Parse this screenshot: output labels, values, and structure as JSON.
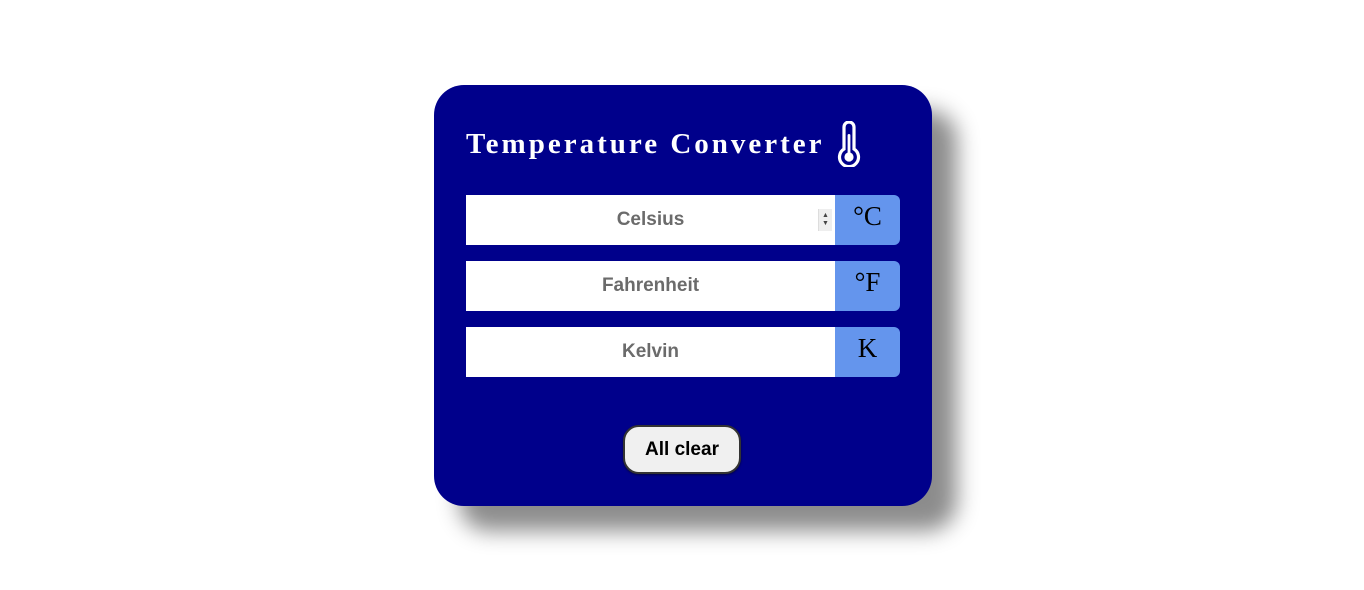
{
  "header": {
    "title": "Temperature Converter",
    "icon": "thermometer-icon"
  },
  "fields": [
    {
      "placeholder": "Celsius",
      "value": "",
      "unit": "°C"
    },
    {
      "placeholder": "Fahrenheit",
      "value": "",
      "unit": "°F"
    },
    {
      "placeholder": "Kelvin",
      "value": "",
      "unit": "K"
    }
  ],
  "actions": {
    "clear_label": "All clear"
  },
  "colors": {
    "card_background": "#00008b",
    "unit_background": "#6495ed",
    "title_text": "#ffffff",
    "button_background": "#f0f0f0"
  }
}
